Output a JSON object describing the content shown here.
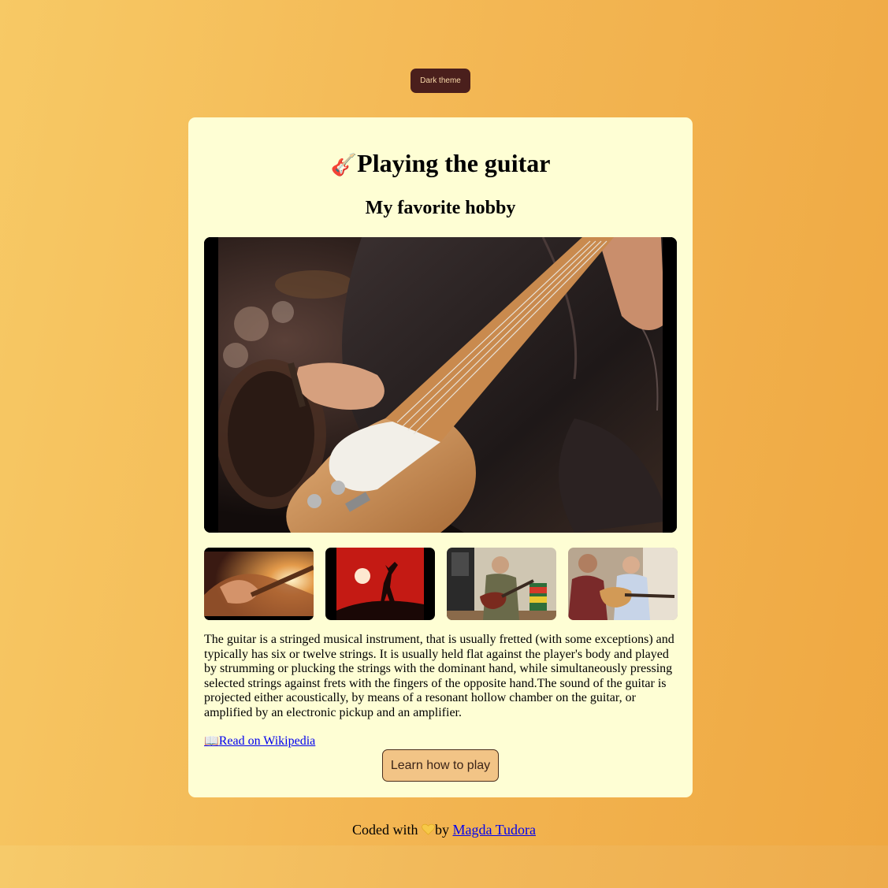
{
  "theme_toggle": {
    "label": "Dark theme"
  },
  "card": {
    "title_icon": "🎸",
    "title": "Playing the guitar",
    "subtitle": "My favorite hobby",
    "hero_image": {
      "icon": "guitarist-photo"
    },
    "thumbnails": [
      {
        "icon": "acoustic-guitar-closeup-photo"
      },
      {
        "icon": "guitarist-silhouette-sunset-photo"
      },
      {
        "icon": "man-playing-electric-guitar-photo"
      },
      {
        "icon": "guitar-lesson-photo"
      }
    ],
    "description": "The guitar is a stringed musical instrument, that is usually fretted (with some exceptions) and typically has six or twelve strings. It is usually held flat against the player's body and played by strumming or plucking the strings with the dominant hand, while simultaneously pressing selected strings against frets with the fingers of the opposite hand.The sound of the guitar is projected either acoustically, by means of a resonant hollow chamber on the guitar, or amplified by an electronic pickup and an amplifier.",
    "wiki_icon": "📖",
    "wiki_link": "Read on Wikipedia",
    "learn_button": "Learn how to play"
  },
  "footer": {
    "prefix": "Coded with",
    "heart_icon": "yellow-heart-icon",
    "by": "by",
    "author": "Magda Tudora"
  },
  "colors": {
    "background_start": "#f7c965",
    "background_end": "#efa842",
    "card": "#fefed4",
    "theme_button": "#4a1f1c",
    "learn_button": "#f2c486",
    "link": "#0000ee"
  }
}
